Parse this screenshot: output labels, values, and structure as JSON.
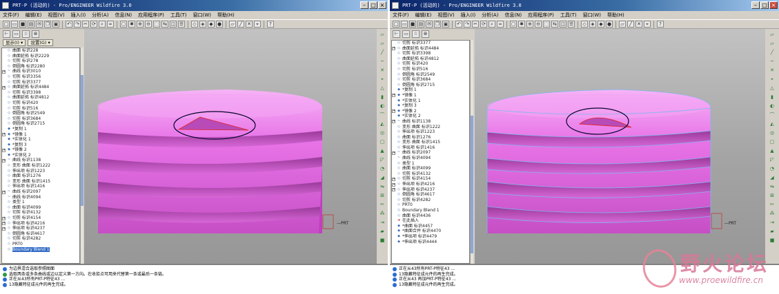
{
  "colors": {
    "model": "#e06fe0",
    "model_light": "#f3a8f3",
    "highlight_ring": "#0a0a30",
    "edge_selection": "#7fb8ee",
    "titlebar": "#0a246a"
  },
  "left": {
    "title": "PRT-P (活动的) - Pro/ENGINEER Wildfire 3.0",
    "menu": [
      "文件(F)",
      "编辑(E)",
      "视图(V)",
      "插入(I)",
      "分析(A)",
      "信息(N)",
      "应用程序(P)",
      "工具(T)",
      "窗口(W)",
      "帮助(H)"
    ],
    "tree_tabs": [
      "显示(I) ▾",
      "设置(G) ▾"
    ],
    "tree": [
      {
        "label": "曲面 标识228",
        "mark": "◇",
        "exp": ""
      },
      {
        "label": "曲面延拓 标识2229",
        "mark": "◇",
        "exp": ""
      },
      {
        "label": "切剪 标识278",
        "mark": "◇",
        "exp": ""
      },
      {
        "label": "倒圆角 标识2280",
        "mark": "◇",
        "exp": ""
      },
      {
        "label": "曲线 标识3010",
        "mark": "~",
        "exp": "+"
      },
      {
        "label": "切剪 标识3356",
        "mark": "◇",
        "exp": ""
      },
      {
        "label": "切剪 标识3377",
        "mark": "◇",
        "exp": ""
      },
      {
        "label": "曲面延拓 标识4484",
        "mark": "◇",
        "exp": "+"
      },
      {
        "label": "切剪 标识3398",
        "mark": "◇",
        "exp": ""
      },
      {
        "label": "曲面延拓 标识4812",
        "mark": "◇",
        "exp": ""
      },
      {
        "label": "切剪 标识420",
        "mark": "◇",
        "exp": ""
      },
      {
        "label": "切剪 标识516",
        "mark": "◇",
        "exp": ""
      },
      {
        "label": "倒圆角 标识2549",
        "mark": "◇",
        "exp": ""
      },
      {
        "label": "切剪 标识3684",
        "mark": "◇",
        "exp": ""
      },
      {
        "label": "倒圆角 标识2715",
        "mark": "◇",
        "exp": ""
      },
      {
        "label": "*复制 1",
        "mark": "◆",
        "exp": ""
      },
      {
        "label": "*镜像 1",
        "mark": "◆",
        "exp": "+"
      },
      {
        "label": "*实体化 1",
        "mark": "◆",
        "exp": ""
      },
      {
        "label": "*复制 3",
        "mark": "◆",
        "exp": ""
      },
      {
        "label": "*镜像 2",
        "mark": "◆",
        "exp": "+"
      },
      {
        "label": "*实体化 2",
        "mark": "◆",
        "exp": ""
      },
      {
        "label": "曲线 标识1138",
        "mark": "~",
        "exp": "+"
      },
      {
        "label": "变形 曲面 标识1222",
        "mark": "◇",
        "exp": ""
      },
      {
        "label": "伸出项 标识1223",
        "mark": "◇",
        "exp": ""
      },
      {
        "label": "曲面 标识1276",
        "mark": "◇",
        "exp": ""
      },
      {
        "label": "变形 曲面 标识1415",
        "mark": "◇",
        "exp": ""
      },
      {
        "label": "伸出项 标识1416",
        "mark": "◇",
        "exp": ""
      },
      {
        "label": "曲线 标识2097",
        "mark": "~",
        "exp": "+"
      },
      {
        "label": "曲线 标识4094",
        "mark": "~",
        "exp": ""
      },
      {
        "label": "类型 1",
        "mark": "◇",
        "exp": ""
      },
      {
        "label": "曲面 标识4099",
        "mark": "◇",
        "exp": ""
      },
      {
        "label": "切剪 标识4132",
        "mark": "◇",
        "exp": ""
      },
      {
        "label": "切剪 标识4154",
        "mark": "◇",
        "exp": "+"
      },
      {
        "label": "伸出项 标识4216",
        "mark": "◇",
        "exp": "+"
      },
      {
        "label": "伸出项 标识4237",
        "mark": "◇",
        "exp": "+"
      },
      {
        "label": "倒圆角 标识4617",
        "mark": "◇",
        "exp": ""
      },
      {
        "label": "切剪 标识4282",
        "mark": "◇",
        "exp": ""
      },
      {
        "label": "PRT0",
        "mark": "◇",
        "exp": ""
      },
      {
        "label": "Boundary Blend 1",
        "mark": "◇",
        "exp": "",
        "selected": true
      }
    ],
    "messages": [
      {
        "type": "info",
        "text": "为边界混合选取参照图面"
      },
      {
        "type": "prompt",
        "text": "选取两条或多条曲线或边以定义第一方向。在收拾点可用来代替第一条或最后一条链。"
      },
      {
        "type": "info",
        "text": "正在从43所有PRT-P特征43 ..."
      },
      {
        "type": "info",
        "text": "13隐藏特征成元件的再生完成。"
      }
    ],
    "model_label": "—PRT"
  },
  "right": {
    "title": "PRT-P (活动的) - Pro/ENGINEER Wildfire 3.0",
    "menu": [
      "文件(F)",
      "编辑(E)",
      "视图(V)",
      "插入(I)",
      "分析(A)",
      "信息(N)",
      "应用程序(P)",
      "工具(T)",
      "窗口(W)",
      "帮助(H)"
    ],
    "tree": [
      {
        "label": "切剪 标识3377",
        "mark": "◇",
        "exp": ""
      },
      {
        "label": "曲面延拓 标识4484",
        "mark": "◇",
        "exp": "+"
      },
      {
        "label": "切剪 标识3398",
        "mark": "◇",
        "exp": ""
      },
      {
        "label": "曲面延拓 标识4812",
        "mark": "◇",
        "exp": ""
      },
      {
        "label": "切剪 标识420",
        "mark": "◇",
        "exp": ""
      },
      {
        "label": "切剪 标识516",
        "mark": "◇",
        "exp": ""
      },
      {
        "label": "倒圆角 标识2549",
        "mark": "◇",
        "exp": ""
      },
      {
        "label": "切剪 标识3684",
        "mark": "◇",
        "exp": ""
      },
      {
        "label": "倒圆角 标识2715",
        "mark": "◇",
        "exp": ""
      },
      {
        "label": "*复制 1",
        "mark": "◆",
        "exp": ""
      },
      {
        "label": "*镜像 1",
        "mark": "◆",
        "exp": "+"
      },
      {
        "label": "*实体化 1",
        "mark": "◆",
        "exp": ""
      },
      {
        "label": "*复制 3",
        "mark": "◆",
        "exp": ""
      },
      {
        "label": "*镜像 2",
        "mark": "◆",
        "exp": "+"
      },
      {
        "label": "*实体化 2",
        "mark": "◆",
        "exp": ""
      },
      {
        "label": "曲线 标识1138",
        "mark": "~",
        "exp": "+"
      },
      {
        "label": "变形 曲面 标识1222",
        "mark": "◇",
        "exp": ""
      },
      {
        "label": "伸出项 标识1223",
        "mark": "◇",
        "exp": ""
      },
      {
        "label": "曲面 标识1276",
        "mark": "◇",
        "exp": ""
      },
      {
        "label": "变形 曲面 标识1415",
        "mark": "◇",
        "exp": ""
      },
      {
        "label": "伸出项 标识1416",
        "mark": "◇",
        "exp": ""
      },
      {
        "label": "曲线 标识2097",
        "mark": "~",
        "exp": "+"
      },
      {
        "label": "曲线 标识4094",
        "mark": "~",
        "exp": ""
      },
      {
        "label": "类型 1",
        "mark": "◇",
        "exp": ""
      },
      {
        "label": "曲面 标识4099",
        "mark": "◇",
        "exp": ""
      },
      {
        "label": "切剪 标识4132",
        "mark": "◇",
        "exp": ""
      },
      {
        "label": "切剪 标识4154",
        "mark": "◇",
        "exp": "+"
      },
      {
        "label": "伸出项 标识4216",
        "mark": "◇",
        "exp": "+"
      },
      {
        "label": "伸出项 标识4237",
        "mark": "◇",
        "exp": "+"
      },
      {
        "label": "倒圆角 标识4617",
        "mark": "◇",
        "exp": ""
      },
      {
        "label": "切剪 标识4282",
        "mark": "◇",
        "exp": ""
      },
      {
        "label": "PRT0",
        "mark": "◇",
        "exp": ""
      },
      {
        "label": "Boundary Blend 1",
        "mark": "◇",
        "exp": ""
      },
      {
        "label": "曲面 标识4436",
        "mark": "◇",
        "exp": ""
      },
      {
        "label": "在此插入",
        "mark": "➜",
        "exp": "",
        "cursor": true
      },
      {
        "label": "*曲面 标识4457",
        "mark": "◆",
        "exp": ""
      },
      {
        "label": "*曲面合并 标识4470",
        "mark": "◆",
        "exp": ""
      },
      {
        "label": "*伸出项 标识4479",
        "mark": "◆",
        "exp": ""
      },
      {
        "label": "*伸出项 标识4444",
        "mark": "◆",
        "exp": ""
      }
    ],
    "messages": [
      {
        "type": "info",
        "text": "正在从43所有PRT-P特征43 ..."
      },
      {
        "type": "info",
        "text": "13隐藏特征成元件的再生完成。"
      },
      {
        "type": "info",
        "text": "正在从43 再加PRT-P特征43 ..."
      },
      {
        "type": "info",
        "text": "13隐藏特征成元件的再生完成。"
      }
    ],
    "model_label": "—PRT"
  },
  "watermark": {
    "title": "野火论坛",
    "url": "www.proewildfire.cn"
  }
}
